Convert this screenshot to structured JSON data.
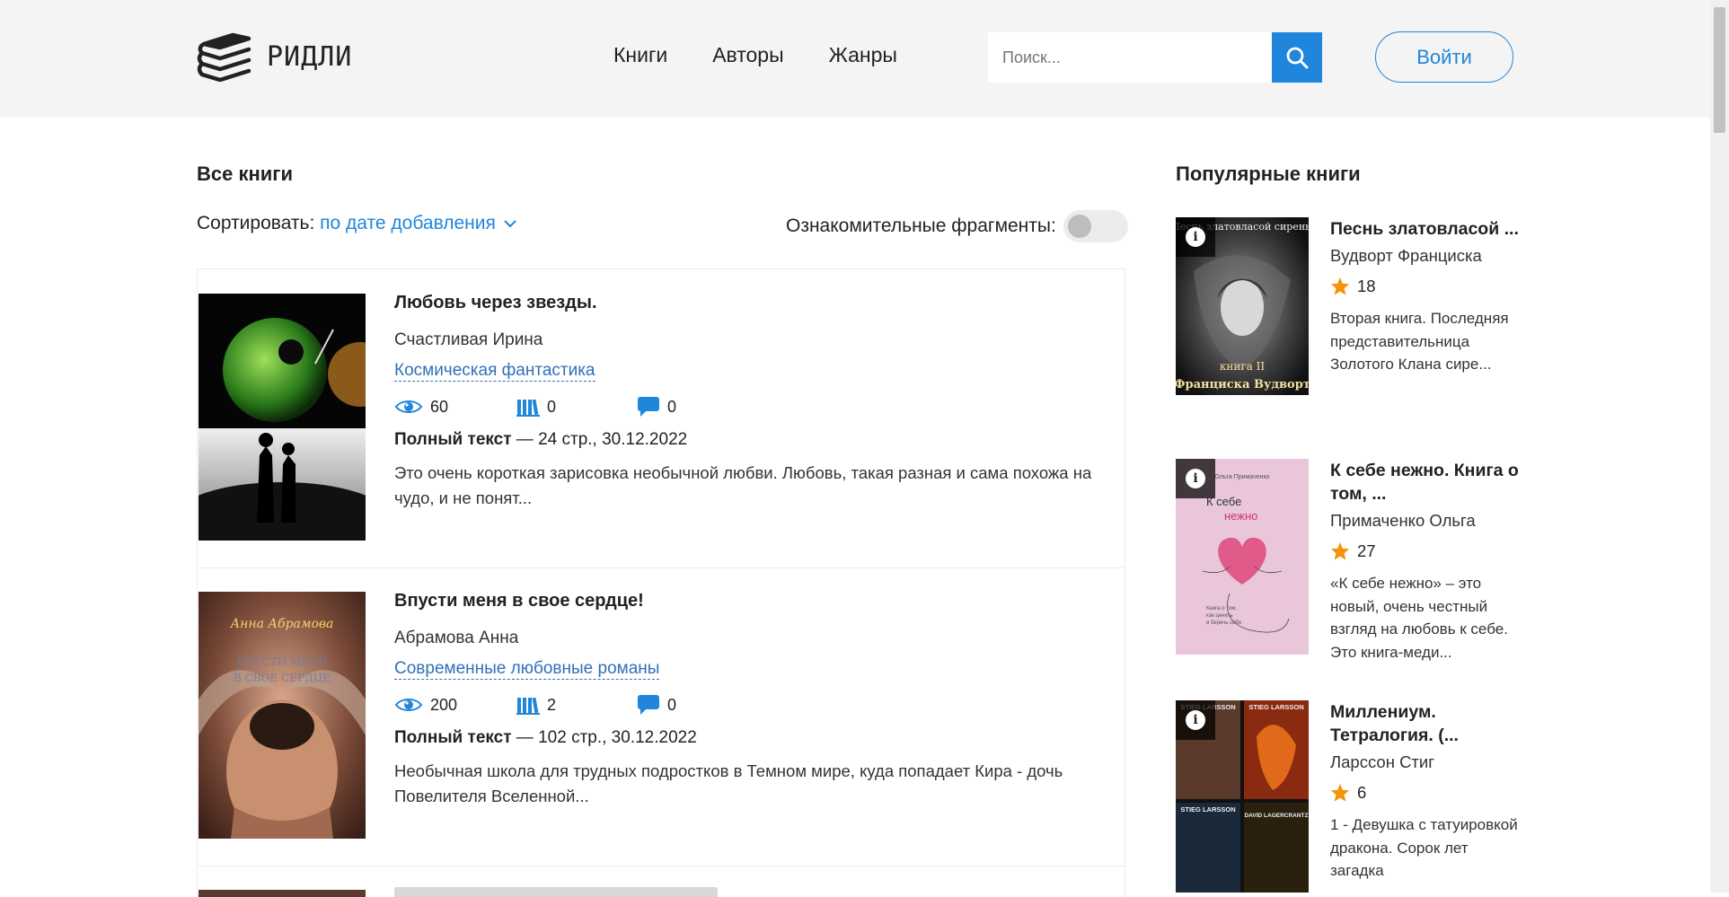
{
  "header": {
    "logo_text": "РИДЛИ",
    "nav": [
      "Книги",
      "Авторы",
      "Жанры"
    ],
    "search_placeholder": "Поиск...",
    "login_label": "Войти"
  },
  "main": {
    "heading": "Все книги",
    "sort_label": "Сортировать:",
    "sort_value": "по дате добавления",
    "fragments_label": "Ознакомительные фрагменты:",
    "fragments_enabled": false,
    "books": [
      {
        "title": "Любовь через звезды.",
        "author": "Счастливая Ирина",
        "genre": "Космическая фантастика",
        "views": "60",
        "libraries": "0",
        "comments": "0",
        "text_type": "Полный текст",
        "meta": " — 24 стр., 30.12.2022",
        "description": "Это очень короткая зарисовка необычной любви. Любовь, такая разная и сама похожа на чудо, и не понят..."
      },
      {
        "title": "Впусти меня в свое сердце!",
        "author": "Абрамова Анна",
        "genre": "Современные любовные романы",
        "views": "200",
        "libraries": "2",
        "comments": "0",
        "text_type": "Полный текст",
        "meta": " — 102 стр., 30.12.2022",
        "description": "Необычная школа для трудных подростков в Темном мире, куда попадает Кира - дочь Повелителя Вселенной...",
        "cover_text": [
          "Анна Абрамова",
          "ВПУСТИ МЕНЯ",
          "В СВОЕ СЕРДЦЕ"
        ]
      }
    ]
  },
  "sidebar": {
    "heading": "Популярные книги",
    "books": [
      {
        "title": "Песнь златовласой ...",
        "author": "Вудворт Франциска",
        "rating": "18",
        "description": "Вторая книга. Последняя представительница Золотого Клана сире...",
        "cover_text": [
          "Песнь златовласой сирены",
          "книга II",
          "Франциска Вудворт"
        ]
      },
      {
        "title": "К себе нежно. Книга о том, ...",
        "author": "Примаченко Ольга",
        "rating": "27",
        "description": "«К себе нежно» – это новый, очень честный взгляд на любовь к себе. Это книга-меди...",
        "cover_text": [
          "Ольга Примаченко",
          "К себе",
          "нежно",
          "Книга о том,",
          "как ценить",
          "и беречь себя"
        ]
      },
      {
        "title": "Миллениум. Тетралогия. (...",
        "author": "Ларссон Стиг",
        "rating": "6",
        "description": "1 - Девушка с татуировкой дракона. Сорок лет загадка",
        "cover_text": [
          "STIEG LARSSON",
          "STIEG LARSSON",
          "STIEG LARSSON",
          "DAVID LAGERCRANTZ"
        ]
      }
    ]
  },
  "colors": {
    "accent": "#1f86dc",
    "genre_link": "#2f70b8",
    "star": "#f5930a",
    "header_bg": "#f4f4f4"
  }
}
